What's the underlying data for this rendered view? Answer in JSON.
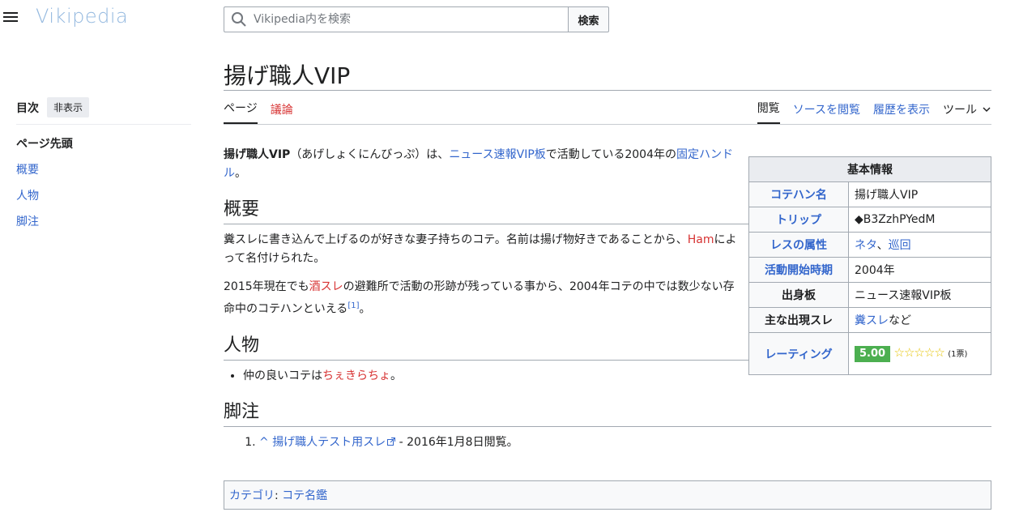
{
  "header": {
    "logo": "Vikipedia",
    "search_placeholder": "Vikipedia内を検索",
    "search_button": "検索"
  },
  "toc": {
    "title": "目次",
    "hide": "非表示",
    "items": [
      "ページ先頭",
      "概要",
      "人物",
      "脚注"
    ]
  },
  "page": {
    "title": "揚げ職人VIP",
    "tabs_left": [
      "ページ",
      "議論"
    ],
    "tabs_right": [
      "閲覧",
      "ソースを閲覧",
      "履歴を表示"
    ],
    "tools": "ツール"
  },
  "lead": {
    "bold": "揚げ職人VIP",
    "reading": "（あげしょくにんびっぷ）は、",
    "link1": "ニュース速報VIP板",
    "mid": "で活動している2004年の",
    "link2": "固定ハンドル",
    "end": "。"
  },
  "sections": {
    "overview": {
      "heading": "概要",
      "p1_a": "糞スレに書き込んで上げるのが好きな妻子持ちのコテ。名前は揚げ物好きであることから、",
      "p1_link": "Ham",
      "p1_b": "によって名付けられた。",
      "p2_a": "2015年現在でも",
      "p2_link": "酒スレ",
      "p2_b": "の避難所で活動の形跡が残っている事から、2004年コテの中では数少ない存命中のコテハンといえる",
      "p2_ref": "[1]",
      "p2_end": "。"
    },
    "person": {
      "heading": "人物",
      "item_a": "仲の良いコテは",
      "item_link": "ちぇきらちょ",
      "item_end": "。"
    },
    "notes": {
      "heading": "脚注",
      "caret": "^",
      "ref_link": "揚げ職人テスト用スレ",
      "ref_rest": " - 2016年1月8日閲覧。"
    }
  },
  "infobox": {
    "title": "基本情報",
    "rows": [
      {
        "label": "コテハン名",
        "value": "揚げ職人VIP"
      },
      {
        "label": "トリップ",
        "value": "◆B3ZzhPYedM"
      },
      {
        "label": "レスの属性",
        "value_link1": "ネタ",
        "sep": "、",
        "value_link2": "巡回"
      },
      {
        "label": "活動開始時期",
        "value": "2004年"
      },
      {
        "label": "出身板",
        "value": "ニュース速報VIP板"
      },
      {
        "label": "主な出現スレ",
        "value_link": "糞スレ",
        "value_rest": "など"
      },
      {
        "label": "レーティング",
        "score": "5.00",
        "stars": "☆☆☆☆☆",
        "votes": "(1票)"
      }
    ]
  },
  "categories": {
    "label": "カテゴリ",
    "colon": ":",
    "item": "コテ名鑑"
  }
}
